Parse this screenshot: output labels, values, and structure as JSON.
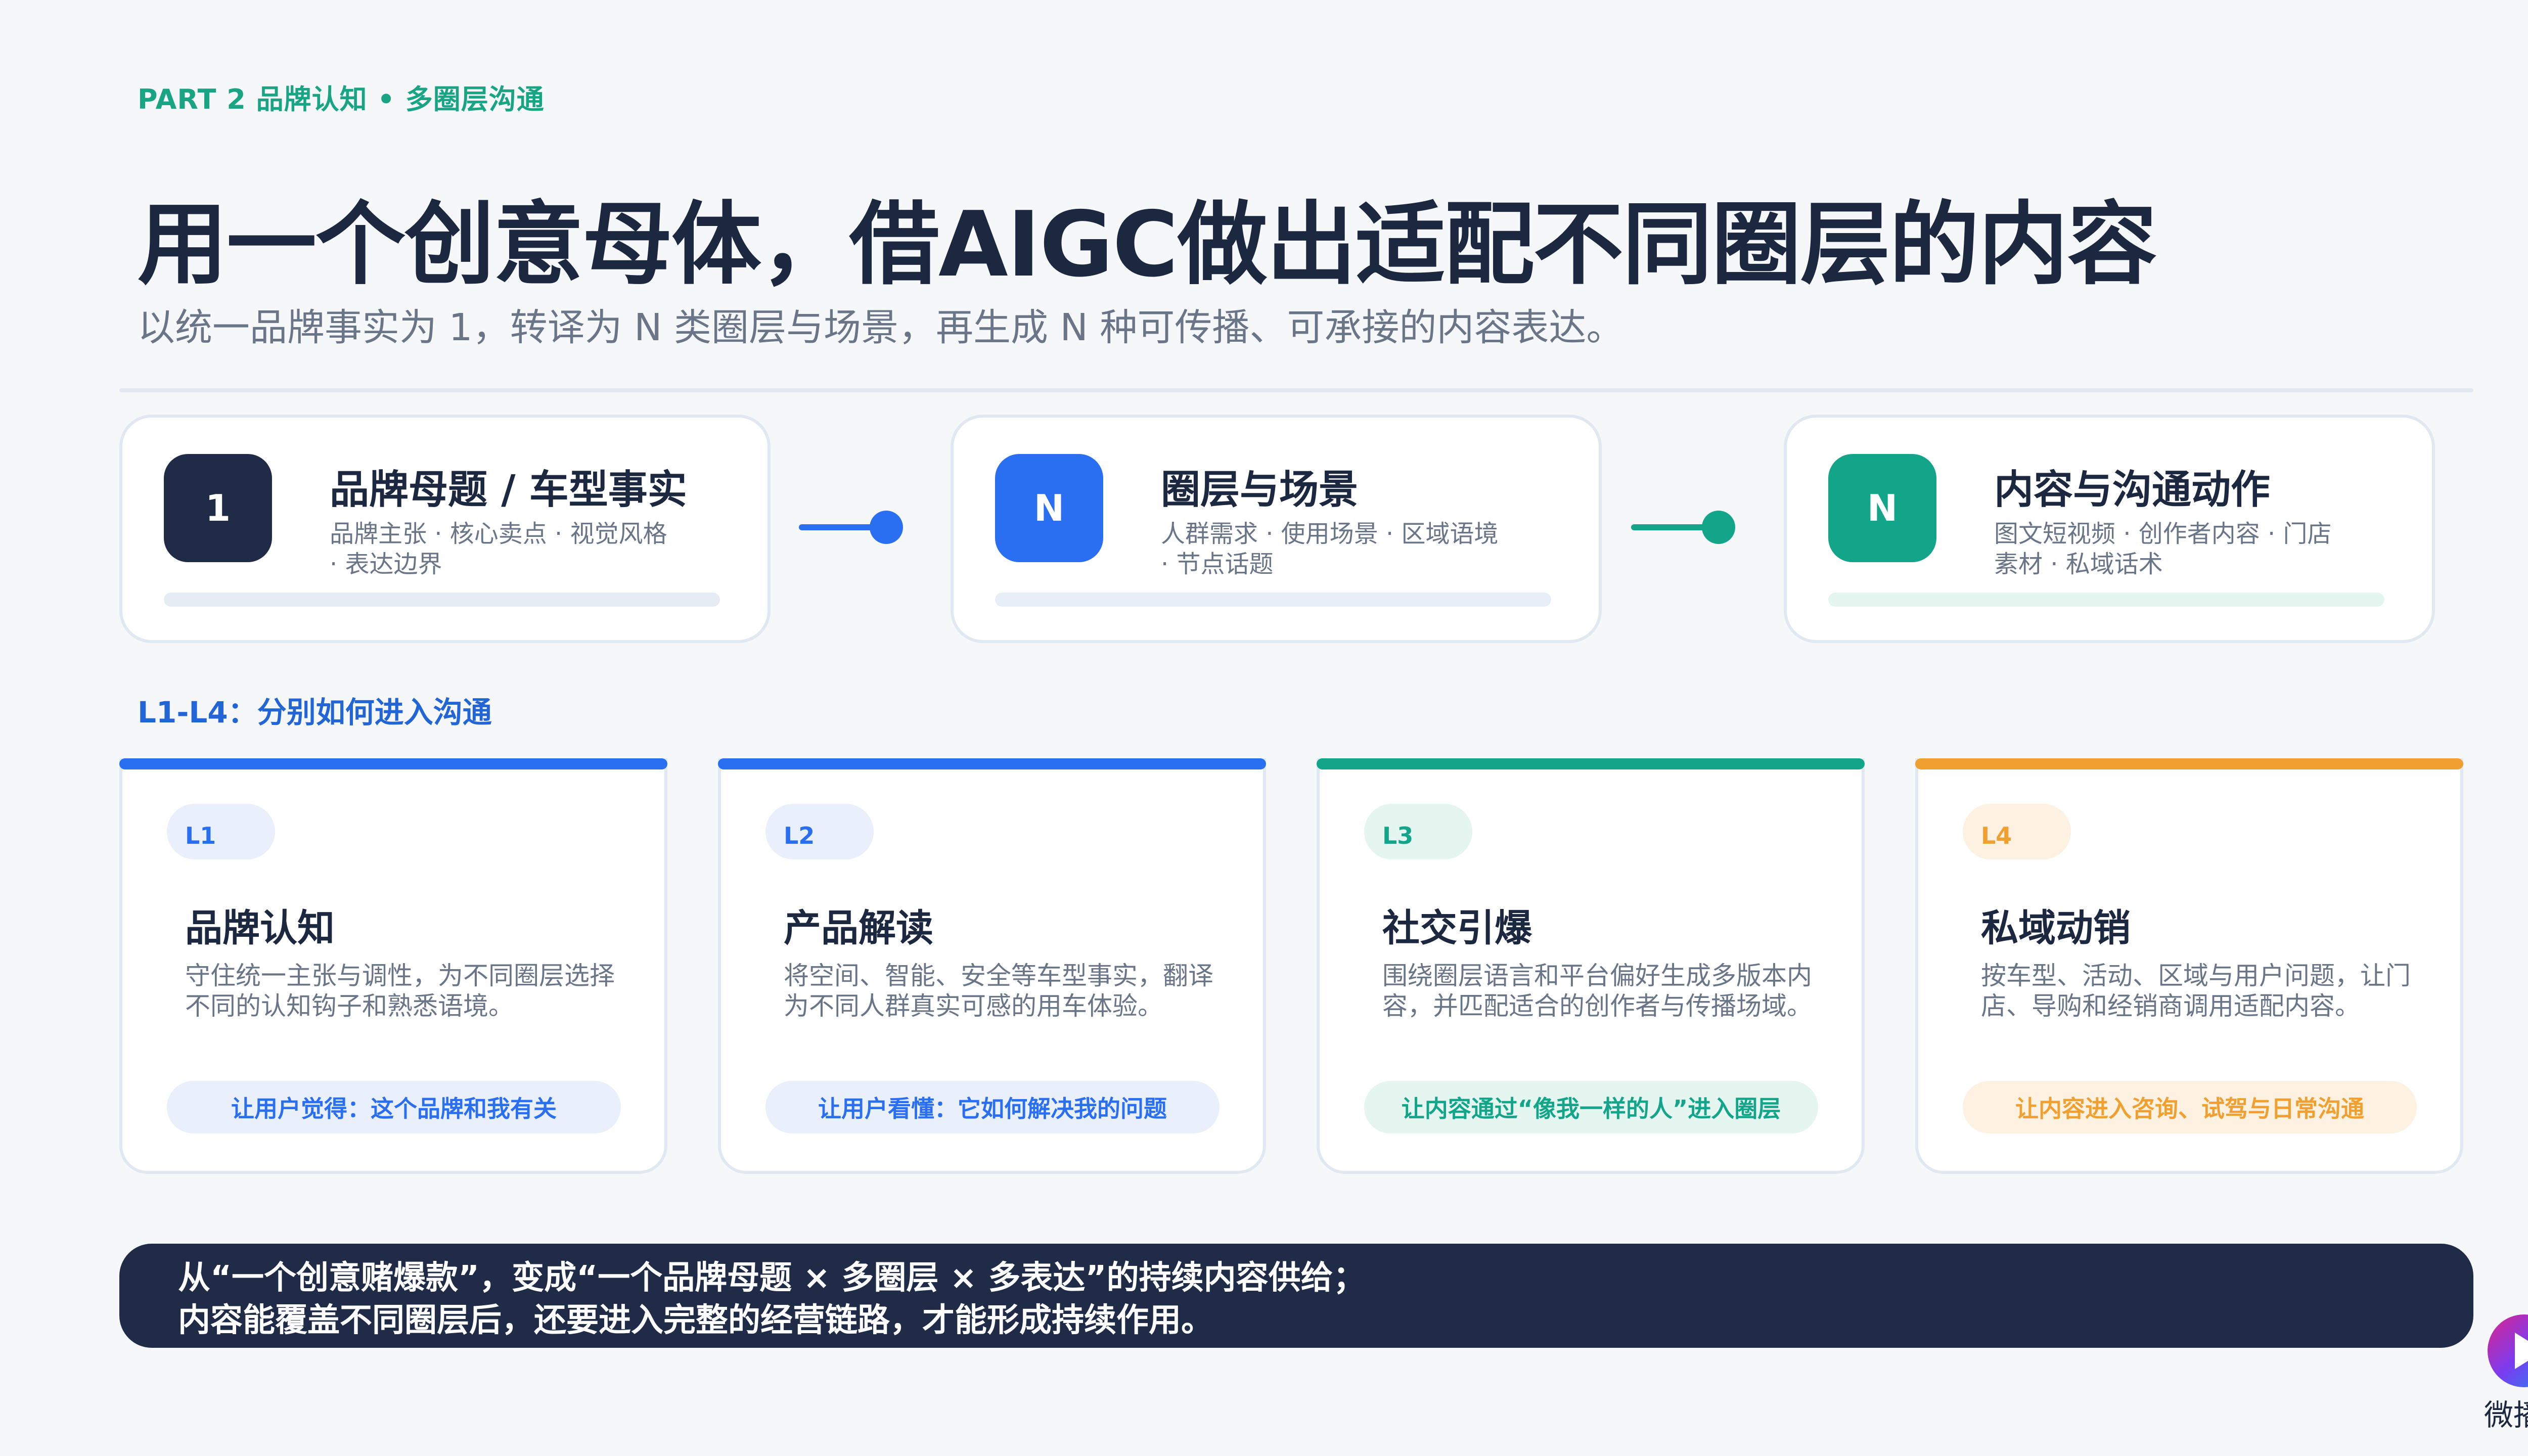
{
  "header": {
    "section_tag": "PART 2 品牌认知 • 多圈层沟通",
    "title": "用一个创意母体，借AIGC做出适配不同圈层的内容",
    "subtitle": "以统一品牌事实为 1，转译为 N 类圈层与场景，再生成 N 种可传播、可承接的内容表达。"
  },
  "flow": [
    {
      "badge": "1",
      "title": "品牌母题 / 车型事实",
      "desc": "品牌主张 · 核心卖点 · 视觉风格 · 表达边界",
      "color": "#1f2b47",
      "bar_color": "#e6ecf4"
    },
    {
      "badge": "N",
      "title": "圈层与场景",
      "desc": "人群需求 · 使用场景 · 区域语境 · 节点话题",
      "color": "#2a6ff2",
      "bar_color": "#e8eef8"
    },
    {
      "badge": "N",
      "title": "内容与沟通动作",
      "desc": "图文短视频 · 创作者内容 · 门店素材 · 私域话术",
      "color": "#12a58a",
      "bar_color": "#e5f5ef"
    }
  ],
  "connectors": [
    {
      "color": "#2a6ff2"
    },
    {
      "color": "#12a58a"
    }
  ],
  "levels_heading": "L1-L4：分别如何进入沟通",
  "levels": [
    {
      "tag": "L1",
      "title": "品牌认知",
      "desc": "守住统一主张与调性，为不同圈层选择不同的认知钩子和熟悉语境。",
      "note": "让用户觉得：这个品牌和我有关",
      "accent": "#2a6ff2",
      "tint": "#e9f0fc"
    },
    {
      "tag": "L2",
      "title": "产品解读",
      "desc": "将空间、智能、安全等车型事实，翻译为不同人群真实可感的用车体验。",
      "note": "让用户看懂：它如何解决我的问题",
      "accent": "#2a6ff2",
      "tint": "#e9f0fc"
    },
    {
      "tag": "L3",
      "title": "社交引爆",
      "desc": "围绕圈层语言和平台偏好生成多版本内容，并匹配适合的创作者与传播场域。",
      "note": "让内容通过“像我一样的人”进入圈层",
      "accent": "#12a58a",
      "tint": "#e5f5ef"
    },
    {
      "tag": "L4",
      "title": "私域动销",
      "desc": "按车型、活动、区域与用户问题，让门店、导购和经销商调用适配内容。",
      "note": "让内容进入咨询、试驾与日常沟通",
      "accent": "#f0a030",
      "tint": "#fdf1e1"
    }
  ],
  "banner": {
    "line1": "从“一个创意赌爆款”，变成“一个品牌母题 × 多圈层 × 多表达”的持续内容供给；",
    "line2": "内容能覆盖不同圈层后，还要进入完整的经营链路，才能形成持续作用。"
  },
  "logo": {
    "text": "微播易",
    "icon": "play-logo-icon"
  }
}
